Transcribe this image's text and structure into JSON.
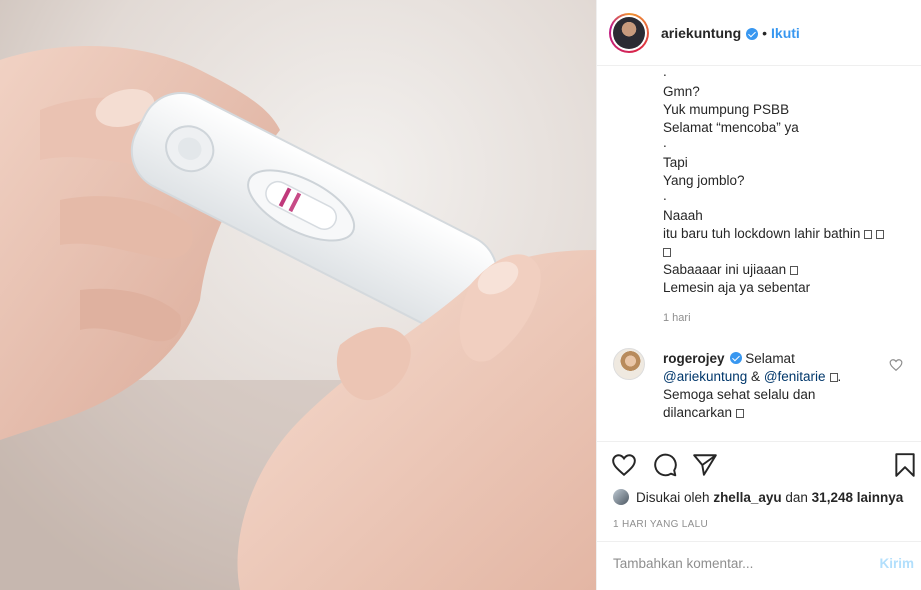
{
  "post": {
    "username": "ariekuntung",
    "separator": "•",
    "follow_label": "Ikuti"
  },
  "caption": {
    "lines": [
      ".",
      "Gmn?",
      "Yuk mumpung PSBB",
      "Selamat “mencoba” ya",
      ".",
      "Tapi",
      "Yang jomblo?",
      ".",
      "Naaah",
      "itu baru tuh lockdown lahir bathin",
      "",
      "Sabaaaar ini ujiaaan",
      "Lemesin aja ya sebentar"
    ],
    "time": "1 hari"
  },
  "comment": {
    "username": "rogerojey",
    "text_1": "Selamat",
    "mention_1": "@ariekuntung",
    "amp": "&",
    "mention_2": "@fenitarie",
    "line_3": "Semoga sehat selalu dan",
    "line_4": "dilancarkan"
  },
  "likes": {
    "prefix": "Disukai oleh",
    "user": "zhella_ayu",
    "middle": "dan",
    "count": "31,248 lainnya"
  },
  "date": "1 HARI YANG LALU",
  "add_comment": {
    "placeholder": "Tambahkan komentar...",
    "post_label": "Kirim"
  },
  "icons": {
    "verified": "verified-badge-icon",
    "like": "heart-icon",
    "comment": "comment-bubble-icon",
    "share": "paper-plane-icon",
    "save": "bookmark-icon"
  },
  "colors": {
    "link": "#3897f0",
    "mention": "#00376b",
    "muted": "#8e8e8e",
    "post_disabled": "#b2dffc"
  }
}
